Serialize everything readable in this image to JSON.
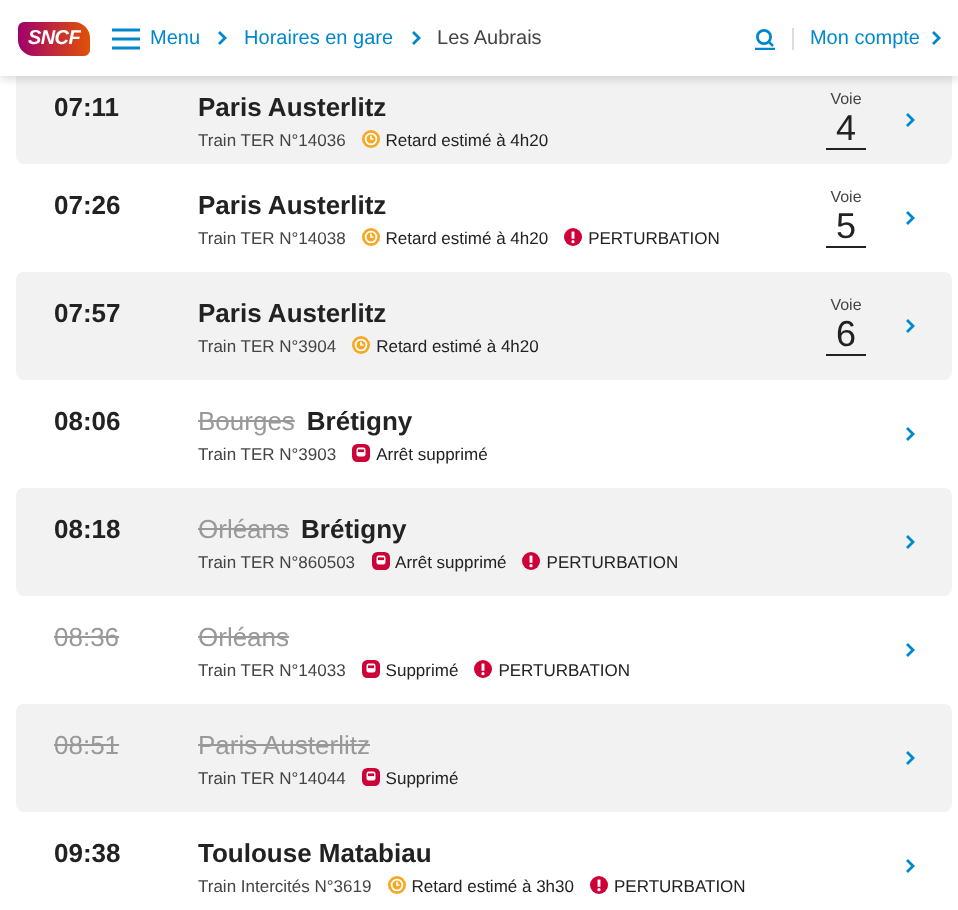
{
  "header": {
    "logo": "SNCF",
    "menu": "Menu",
    "breadcrumbs": [
      "Horaires en gare",
      "Les Aubrais"
    ],
    "account": "Mon compte"
  },
  "departures": [
    {
      "time": "07:11",
      "time_cancelled": false,
      "destinations": [
        {
          "name": "Paris Austerlitz",
          "cancelled": false
        }
      ],
      "train": "Train TER N°14036",
      "statuses": [
        {
          "kind": "delay",
          "label": "Retard estimé à 4h20"
        }
      ],
      "platform": {
        "label": "Voie",
        "number": "4"
      }
    },
    {
      "time": "07:26",
      "time_cancelled": false,
      "destinations": [
        {
          "name": "Paris Austerlitz",
          "cancelled": false
        }
      ],
      "train": "Train TER N°14038",
      "statuses": [
        {
          "kind": "delay",
          "label": "Retard estimé à 4h20"
        },
        {
          "kind": "perturbation",
          "label": "PERTURBATION"
        }
      ],
      "platform": {
        "label": "Voie",
        "number": "5"
      }
    },
    {
      "time": "07:57",
      "time_cancelled": false,
      "destinations": [
        {
          "name": "Paris Austerlitz",
          "cancelled": false
        }
      ],
      "train": "Train TER N°3904",
      "statuses": [
        {
          "kind": "delay",
          "label": "Retard estimé à 4h20"
        }
      ],
      "platform": {
        "label": "Voie",
        "number": "6"
      }
    },
    {
      "time": "08:06",
      "time_cancelled": false,
      "destinations": [
        {
          "name": "Bourges",
          "cancelled": true
        },
        {
          "name": "Brétigny",
          "cancelled": false
        }
      ],
      "train": "Train TER N°3903",
      "statuses": [
        {
          "kind": "stop_removed",
          "label": "Arrêt supprimé"
        }
      ]
    },
    {
      "time": "08:18",
      "time_cancelled": false,
      "destinations": [
        {
          "name": "Orléans",
          "cancelled": true
        },
        {
          "name": "Brétigny",
          "cancelled": false
        }
      ],
      "train": "Train TER N°860503",
      "statuses": [
        {
          "kind": "stop_removed",
          "label": "Arrêt supprimé"
        },
        {
          "kind": "perturbation",
          "label": "PERTURBATION"
        }
      ]
    },
    {
      "time": "08:36",
      "time_cancelled": true,
      "destinations": [
        {
          "name": "Orléans",
          "cancelled": true
        }
      ],
      "train": "Train TER N°14033",
      "statuses": [
        {
          "kind": "cancelled",
          "label": "Supprimé"
        },
        {
          "kind": "perturbation",
          "label": "PERTURBATION"
        }
      ]
    },
    {
      "time": "08:51",
      "time_cancelled": true,
      "destinations": [
        {
          "name": "Paris Austerlitz",
          "cancelled": true
        }
      ],
      "train": "Train TER N°14044",
      "statuses": [
        {
          "kind": "cancelled",
          "label": "Supprimé"
        }
      ]
    },
    {
      "time": "09:38",
      "time_cancelled": false,
      "destinations": [
        {
          "name": "Toulouse Matabiau",
          "cancelled": false
        }
      ],
      "train": "Train Intercités N°3619",
      "statuses": [
        {
          "kind": "delay",
          "label": "Retard estimé à 3h30"
        },
        {
          "kind": "perturbation",
          "label": "PERTURBATION"
        }
      ]
    }
  ]
}
